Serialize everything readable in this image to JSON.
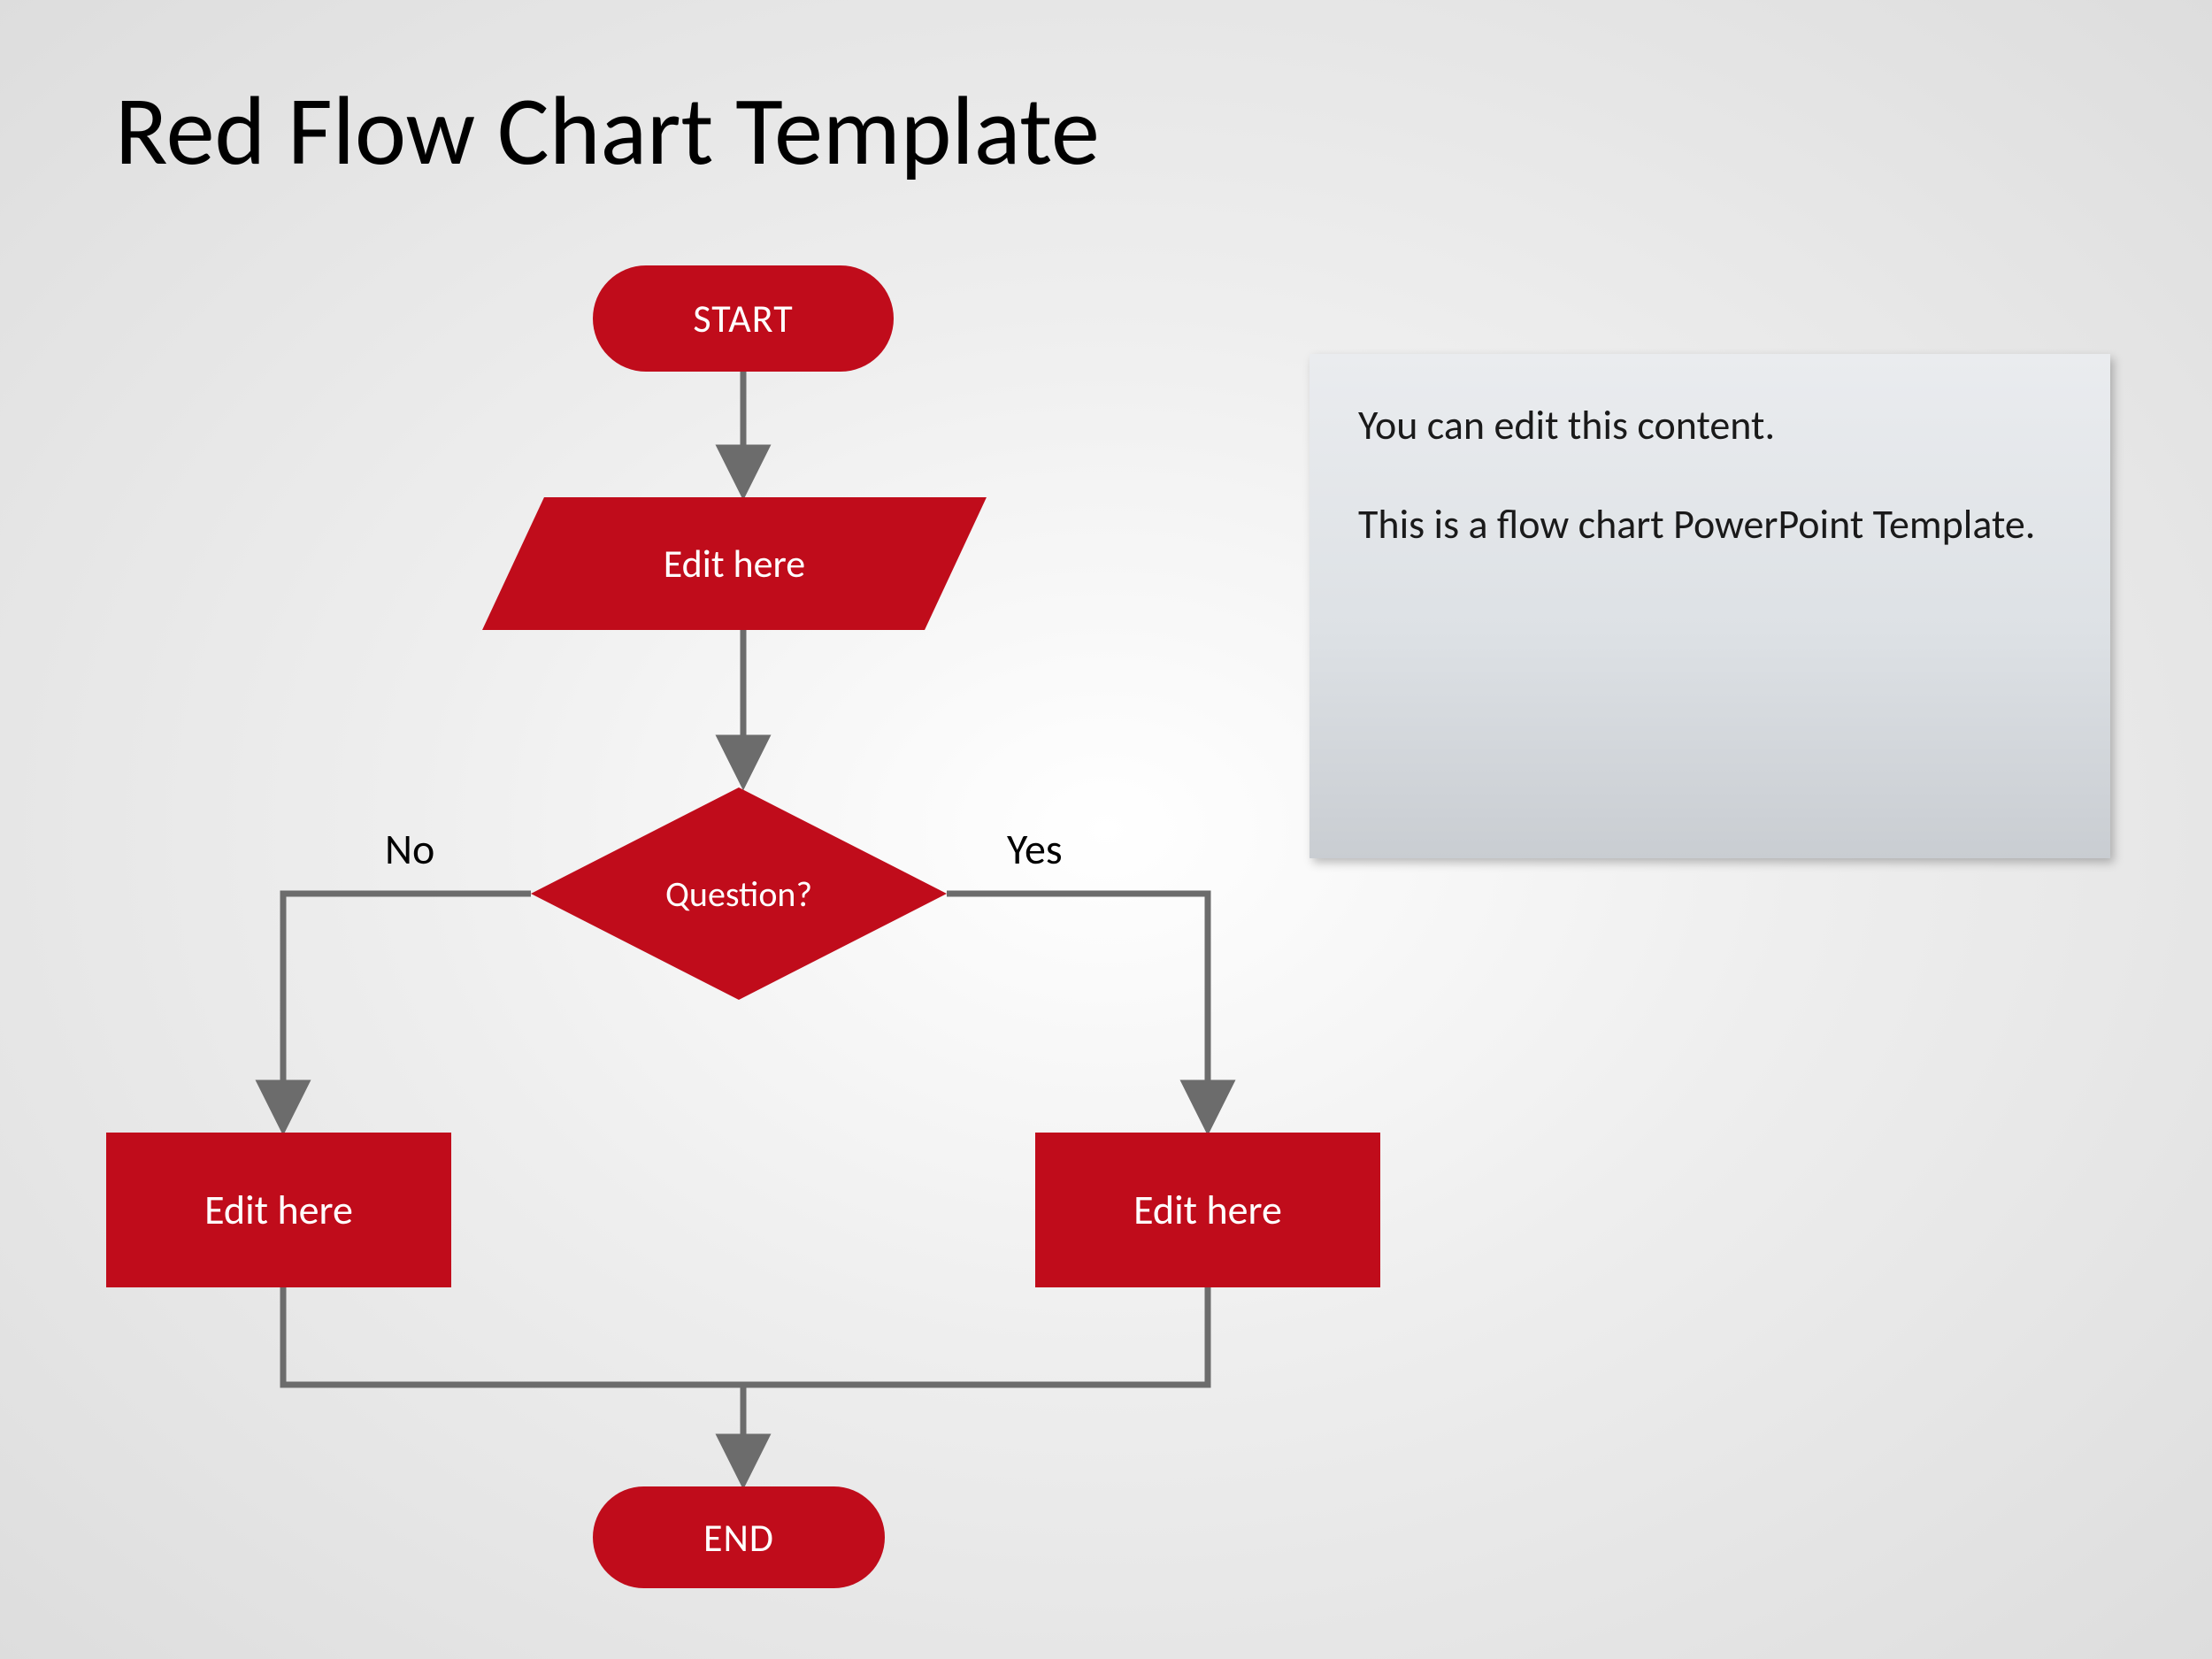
{
  "title": "Red Flow Chart Template",
  "nodes": {
    "start": "START",
    "input": "Edit here",
    "decision": "Question?",
    "process_left": "Edit here",
    "process_right": "Edit here",
    "end": "END"
  },
  "labels": {
    "no": "No",
    "yes": "Yes"
  },
  "infobox": {
    "line1": "You can edit this content.",
    "line2": "This is a flow chart PowerPoint Template."
  },
  "colors": {
    "shape_fill": "#c00c1b",
    "connector": "#6c6c6c"
  }
}
